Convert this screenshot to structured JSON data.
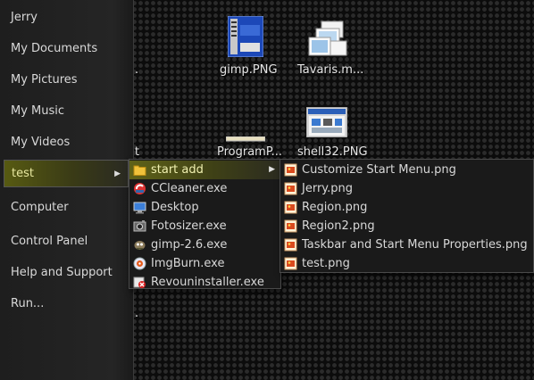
{
  "start_panel": {
    "items": [
      {
        "label": "Jerry"
      },
      {
        "label": "My Documents"
      },
      {
        "label": "My Pictures"
      },
      {
        "label": "My Music"
      },
      {
        "label": "My Videos"
      },
      {
        "label": "test",
        "active": true
      },
      {
        "label": "Computer"
      },
      {
        "label": "Control Panel"
      },
      {
        "label": "Help and Support"
      },
      {
        "label": "Run..."
      }
    ]
  },
  "desktop": {
    "icons": [
      {
        "label": "gimp.PNG"
      },
      {
        "label": "Tavaris.m..."
      },
      {
        "label": "ProgramP..."
      },
      {
        "label": "shell32.PNG"
      }
    ],
    "partial_labels": [
      ".",
      "t",
      "."
    ]
  },
  "test_menu": {
    "items": [
      {
        "label": "start add",
        "icon": "folder-icon",
        "submenu": true
      },
      {
        "label": "CCleaner.exe",
        "icon": "ccleaner-icon"
      },
      {
        "label": "Desktop",
        "icon": "desktop-icon"
      },
      {
        "label": "Fotosizer.exe",
        "icon": "fotosizer-icon"
      },
      {
        "label": "gimp-2.6.exe",
        "icon": "gimp-icon"
      },
      {
        "label": "ImgBurn.exe",
        "icon": "imgburn-icon"
      },
      {
        "label": "Revouninstaller.exe",
        "icon": "revo-icon"
      }
    ]
  },
  "start_add_menu": {
    "items": [
      {
        "label": "Customize Start Menu.png",
        "icon": "png-file-icon"
      },
      {
        "label": "Jerry.png",
        "icon": "png-file-icon"
      },
      {
        "label": "Region.png",
        "icon": "png-file-icon"
      },
      {
        "label": "Region2.png",
        "icon": "png-file-icon"
      },
      {
        "label": "Taskbar and Start Menu Properties.png",
        "icon": "png-file-icon"
      },
      {
        "label": "test.png",
        "icon": "png-file-icon"
      }
    ]
  },
  "colors": {
    "active_highlight": "#5f6218",
    "panel_bg": "#222222",
    "menu_bg": "#1a1a1a"
  }
}
